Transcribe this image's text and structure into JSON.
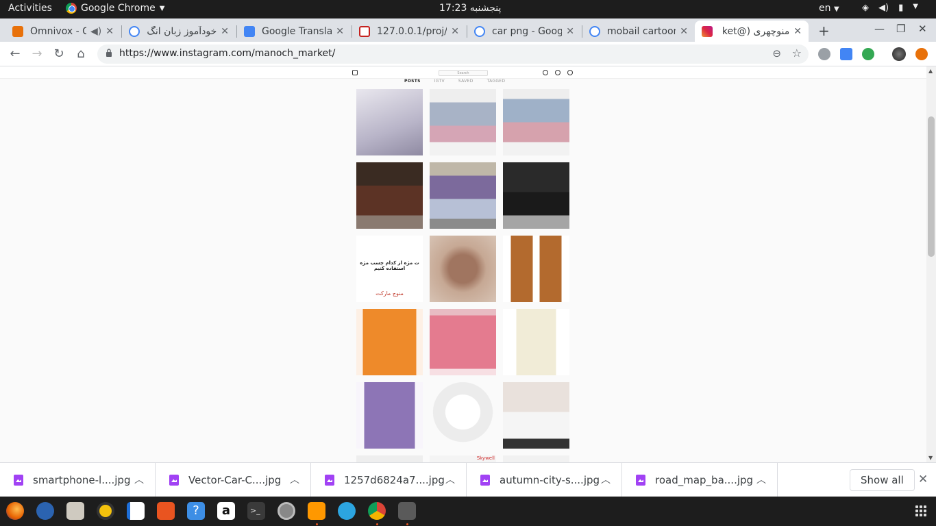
{
  "system": {
    "activities": "Activities",
    "app_name": "Google Chrome",
    "clock": "پنجشنبه 17:23",
    "lang": "en"
  },
  "tabs": [
    {
      "label": "Omnivox - C",
      "color": "#e8710a"
    },
    {
      "label": "خودآموز زبان انگ",
      "color": "#4285f4"
    },
    {
      "label": "Google Translat",
      "color": "#4285f4"
    },
    {
      "label": "127.0.0.1/proj/",
      "color": "#c5221f"
    },
    {
      "label": "car png - Googl",
      "color": "#4285f4"
    },
    {
      "label": "mobail cartoon",
      "color": "#4285f4"
    },
    {
      "label": "منوچهری (@ket",
      "color": "#c13584"
    }
  ],
  "omnibox": {
    "url": "https://www.instagram.com/manoch_market/"
  },
  "instagram": {
    "search_placeholder": "Search",
    "tabs": [
      "POSTS",
      "IGTV",
      "SAVED",
      "TAGGED"
    ],
    "post3_text": "ت مژه از کدام چسب مژه استفاده کنیم",
    "post3_brand": "منوچ مارکت",
    "post14_brand": "Skywell"
  },
  "downloads": [
    {
      "name": "smartphone-l....jpg"
    },
    {
      "name": "Vector-Car-C....jpg"
    },
    {
      "name": "1257d6824a7....jpg"
    },
    {
      "name": "autumn-city-s....jpg"
    },
    {
      "name": "road_map_ba....jpg"
    }
  ],
  "shelf": {
    "show_all": "Show all"
  },
  "colors": {
    "accent": "#e95420",
    "download_icon": "#a142f4"
  }
}
